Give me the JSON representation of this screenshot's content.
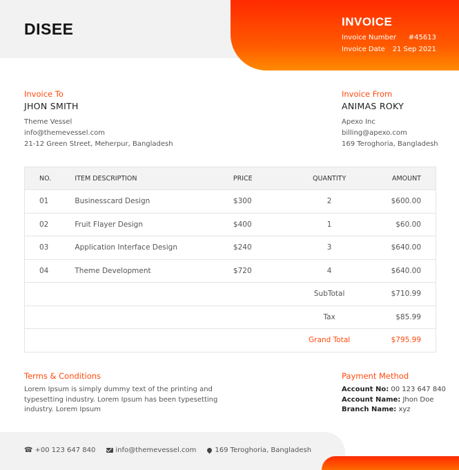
{
  "brand": "DISEE",
  "invoice": {
    "title": "INVOICE",
    "number_label": "Invoice Number",
    "number": "#45613",
    "date_label": "Invoice Date",
    "date": "21 Sep 2021"
  },
  "bill_to": {
    "heading": "Invoice To",
    "name": "JHON SMITH",
    "lines": [
      "Theme Vessel",
      "info@themevessel.com",
      "21-12 Green Street, Meherpur, Bangladesh"
    ]
  },
  "bill_from": {
    "heading": "Invoice From",
    "name": "ANIMAS ROKY",
    "lines": [
      "Apexo Inc",
      "billing@apexo.com",
      "169 Teroghoria, Bangladesh"
    ]
  },
  "table": {
    "headers": [
      "NO.",
      "ITEM DESCRIPTION",
      "PRICE",
      "QUANTITY",
      "AMOUNT"
    ],
    "rows": [
      {
        "no": "01",
        "desc": "Businesscard Design",
        "price": "$300",
        "qty": "2",
        "amount": "$600.00"
      },
      {
        "no": "02",
        "desc": "Fruit Flayer Design",
        "price": "$400",
        "qty": "1",
        "amount": "$60.00"
      },
      {
        "no": "03",
        "desc": "Application Interface Design",
        "price": "$240",
        "qty": "3",
        "amount": "$640.00"
      },
      {
        "no": "04",
        "desc": "Theme Development",
        "price": "$720",
        "qty": "4",
        "amount": "$640.00"
      }
    ],
    "subtotal_label": "SubTotal",
    "subtotal": "$710.99",
    "tax_label": "Tax",
    "tax": "$85.99",
    "grand_total_label": "Grand Total",
    "grand_total": "$795.99"
  },
  "terms": {
    "heading": "Terms & Conditions",
    "text": "Lorem Ipsum is simply dummy text of the printing and typesetting industry. Lorem Ipsum has been typesetting industry. Lorem Ipsum"
  },
  "payment": {
    "heading": "Payment Method",
    "account_no_label": "Account No:",
    "account_no": "00 123 647 840",
    "account_name_label": "Account Name:",
    "account_name": "Jhon Doe",
    "branch_label": "Branch Name:",
    "branch": "xyz"
  },
  "footer": {
    "phone": "+00 123 647 840",
    "email": "info@themevessel.com",
    "address": "169 Teroghoria, Bangladesh"
  },
  "colors": {
    "accent": "#ff4a0e",
    "gradient_start": "#ff2a00",
    "gradient_end": "#ff8a00"
  },
  "icons": [
    "phone-icon",
    "mail-icon",
    "map-pin-icon"
  ]
}
